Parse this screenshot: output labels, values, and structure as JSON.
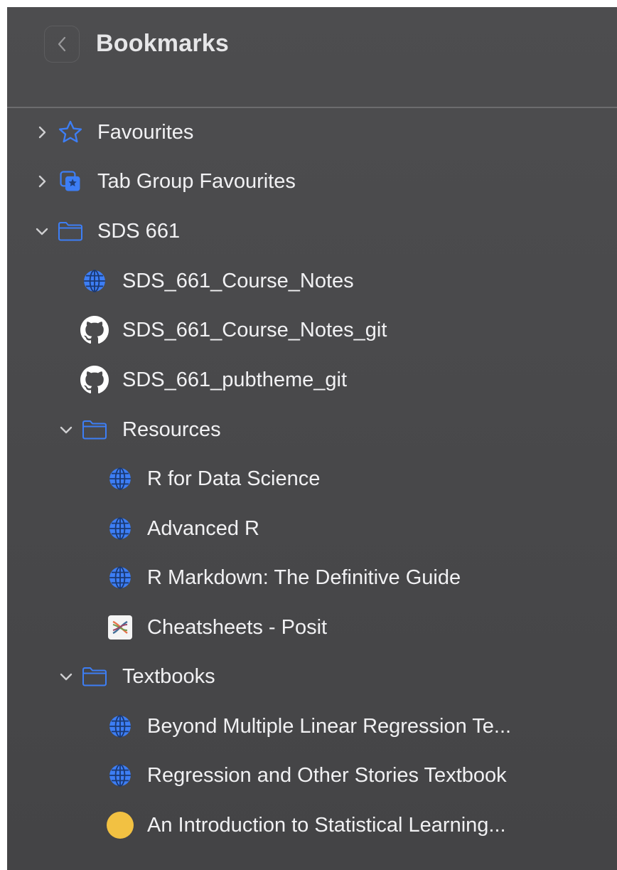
{
  "header": {
    "title": "Bookmarks"
  },
  "tree": [
    {
      "label": "Favourites",
      "icon": "star-icon",
      "chevron": "right"
    },
    {
      "label": "Tab Group Favourites",
      "icon": "tab-group-star-icon",
      "chevron": "right"
    },
    {
      "label": "SDS 661",
      "icon": "folder-icon",
      "chevron": "down"
    },
    {
      "label": "SDS_661_Course_Notes",
      "icon": "globe-icon"
    },
    {
      "label": "SDS_661_Course_Notes_git",
      "icon": "github-icon"
    },
    {
      "label": "SDS_661_pubtheme_git",
      "icon": "github-icon"
    },
    {
      "label": "Resources",
      "icon": "folder-icon",
      "chevron": "down"
    },
    {
      "label": "R for Data Science",
      "icon": "globe-icon"
    },
    {
      "label": "Advanced R",
      "icon": "globe-icon"
    },
    {
      "label": "R Markdown: The Definitive Guide",
      "icon": "globe-icon"
    },
    {
      "label": "Cheatsheets - Posit",
      "icon": "posit-icon"
    },
    {
      "label": "Textbooks",
      "icon": "folder-icon",
      "chevron": "down"
    },
    {
      "label": "Beyond Multiple Linear Regression Te...",
      "icon": "globe-icon"
    },
    {
      "label": "Regression and Other Stories Textbook",
      "icon": "globe-icon"
    },
    {
      "label": "An Introduction to Statistical Learning...",
      "icon": "yellow-circle-icon"
    }
  ],
  "colors": {
    "accent": "#3d7ef5",
    "text": "#f1f1f3",
    "panel": "#4b4b4d"
  }
}
